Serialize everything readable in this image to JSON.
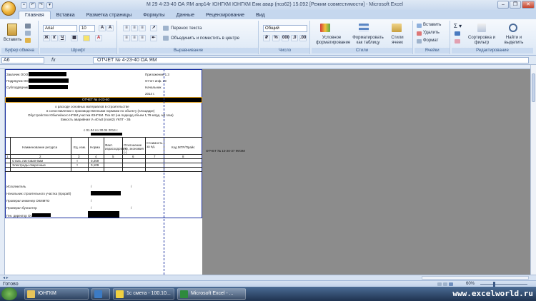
{
  "window": {
    "title": "М 29 4-23-40 ОА ЯМ апр14г ЮНГКМ ЮНГКМ Емк авар (поз62) 15.092 [Режим совместимости] - Microsoft Excel"
  },
  "ribbon": {
    "tabs": [
      "Главная",
      "Вставка",
      "Разметка страницы",
      "Формулы",
      "Данные",
      "Рецензирование",
      "Вид"
    ],
    "clipboard": {
      "paste": "Вставить",
      "label": "Буфер обмена"
    },
    "font": {
      "name": "Arial",
      "size": "10",
      "label": "Шрифт"
    },
    "alignment": {
      "wrap": "Перенос текста",
      "merge": "Объединить и поместить в центре",
      "label": "Выравнивание"
    },
    "number": {
      "format": "Общий",
      "label": "Число"
    },
    "styles": {
      "conditional": "Условное форматирование",
      "as_table": "Форматировать как таблицу",
      "cell_styles": "Стили ячеек",
      "label": "Стили"
    },
    "cells": {
      "insert": "Вставить",
      "delete": "Удалить",
      "format": "Формат",
      "label": "Ячейки"
    },
    "editing": {
      "sort": "Сортировка и фильтр",
      "find": "Найти и выделить",
      "label": "Редактирование"
    }
  },
  "formula_bar": {
    "name_box": "A6",
    "fx": "fx",
    "value": "ОТЧЕТ № 4-23-40 ОА ЯМ"
  },
  "sheet": {
    "customer": "Заказчик ООО",
    "contractor": "Подрядчик ООО",
    "subcontractor": "Субподрядчик ООО",
    "appendix": "Приложение 1.3",
    "report_no_right": "Отчет инф. 29",
    "head": "Начальник",
    "year": "2014 г.",
    "title": "ОТЧЕТ № 4-23-40",
    "desc1": "о расходе основных материалов в строительстве",
    "desc2": "в сопоставлении с производственными нормами по объекту (площадке)",
    "desc3": "Обустройство Юбилейного НГКМ участка ЮНГКМ. Поз 62 (на подкорд объем 1,79 млрд. м3 газа)",
    "desc4": "Емкость аварийная V=40 м3 (поз62) УКПГ - 3Б",
    "period": "с 01.04 по 30.04 2014 г.",
    "col_name": "Наименование ресурса",
    "col_unit": "Ед. изм.",
    "col_norm": "Норма",
    "col_fact": "Факт. израсходовано",
    "col_dev": "Отклонение (+), экономия (-)",
    "col_cost": "Стоимость за ед.",
    "col_code": "Код МТР/Прайс",
    "col_nums": [
      "1",
      "2",
      "3",
      "4",
      "5",
      "6",
      "7",
      "8"
    ],
    "row1": "Сталь листовая 6мм",
    "row2": "Электроды сварочные",
    "row1_unit": "т",
    "row2_unit": "т",
    "row1_val": "0,259",
    "row2_val": "0,109",
    "side_note": "ОТЧЕТ № 10-20-37 ФЛЭМ",
    "sign1": "Исполнитель",
    "sign2": "Начальник строительного участка (прораб)",
    "sign3": "Проверил инженер ОКИМТО",
    "sign4": "Проверил бухгалтер",
    "sign5": "Ген. директор ООО",
    "slash": "/"
  },
  "status": {
    "ready": "Готово",
    "zoom": "60%"
  },
  "taskbar": {
    "items": [
      "ЮНГКМ",
      "",
      "1с смета - 100.10...",
      "Microsoft Excel - ..."
    ],
    "watermark": "www.excelworld.ru"
  }
}
